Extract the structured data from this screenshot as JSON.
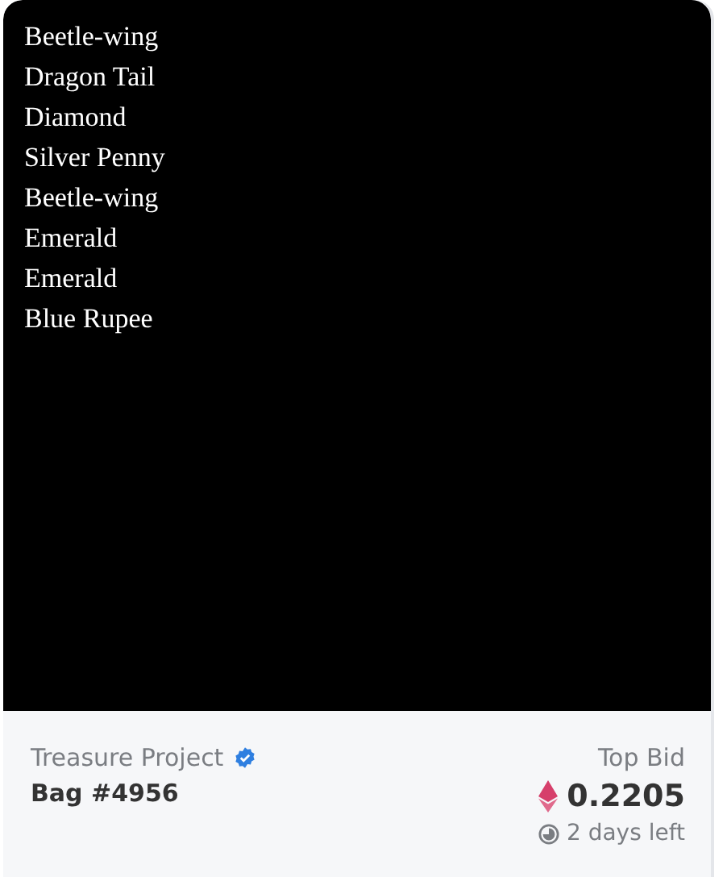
{
  "nft": {
    "items": [
      "Beetle-wing",
      "Dragon Tail",
      "Diamond",
      "Silver Penny",
      "Beetle-wing",
      "Emerald",
      "Emerald",
      "Blue Rupee"
    ]
  },
  "collection": {
    "name": "Treasure Project",
    "verified": true
  },
  "token": {
    "name": "Bag #4956"
  },
  "bid": {
    "label": "Top Bid",
    "amount": "0.2205",
    "time_left": "2 days left"
  }
}
